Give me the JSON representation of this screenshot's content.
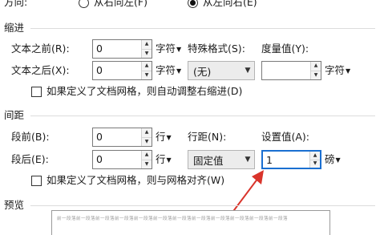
{
  "direction": {
    "label": "方向:",
    "rtl_label": "从右向左(F)",
    "ltr_label": "从左向右(E)",
    "selected": "ltr"
  },
  "indent": {
    "section_title": "缩进",
    "before_label": "文本之前(R):",
    "before_value": "0",
    "before_unit": "字符",
    "after_label": "文本之后(X):",
    "after_value": "0",
    "after_unit": "字符",
    "special_label": "特殊格式(S):",
    "special_value": "(无)",
    "amount_label": "度量值(Y):",
    "amount_value": "",
    "amount_unit": "字符",
    "grid_checkbox_label": "如果定义了文档网格，则自动调整右缩进(D)",
    "grid_checked": false
  },
  "spacing": {
    "section_title": "间距",
    "before_label": "段前(B):",
    "before_value": "0",
    "before_unit": "行",
    "after_label": "段后(E):",
    "after_value": "0",
    "after_unit": "行",
    "line_label": "行距(N):",
    "line_value": "固定值",
    "setting_label": "设置值(A):",
    "setting_value": "1",
    "setting_unit": "磅",
    "grid_checkbox_label": "如果定义了文档网格，则与网格对齐(W)",
    "grid_checked": false
  },
  "preview": {
    "section_title": "预览",
    "sample_text": "前一段落前一段落前一段落前一段落前一段落前一段落前一段落前一段落前一段落前一段落前一段落前一段落"
  },
  "colors": {
    "focus": "#1a6fd1",
    "arrow": "#d9342b"
  }
}
